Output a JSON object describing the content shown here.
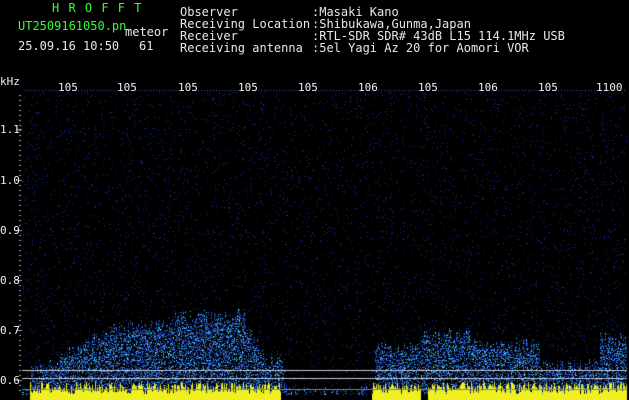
{
  "header": {
    "logo": "H R O F F T",
    "filename": "UT2509161050.pn",
    "mode": "meteor",
    "datetime": "25.09.16 10:50",
    "count": "61",
    "labels": {
      "observer": "Observer",
      "location": "Receiving Location",
      "receiver": "Receiver",
      "antenna": "Receiving antenna"
    },
    "values": {
      "observer": ":Masaki Kano",
      "location": ":Shibukawa,Gunma,Japan",
      "receiver": ":RTL-SDR SDR# 43dB L15 114.1MHz USB",
      "antenna": ":5el Yagi Az 20 for Aomori VOR"
    }
  },
  "axis": {
    "unit": "kHz",
    "y_ticks": [
      "1.1",
      "1.0",
      "0.9",
      "0.8",
      "0.7",
      "0.6"
    ],
    "x_ticks": [
      "105",
      "105",
      "105",
      "105",
      "105",
      "106",
      "105",
      "106",
      "105",
      "1100"
    ]
  },
  "colors": {
    "background": "#000000",
    "axis_text": "#f0f0f0",
    "header_green": "#33ff33",
    "echo_blue": "#2a5fd8",
    "echo_cyan": "#40d0ff",
    "echo_yellow": "#f0f020",
    "noise_dots": "#1a2a90"
  }
}
